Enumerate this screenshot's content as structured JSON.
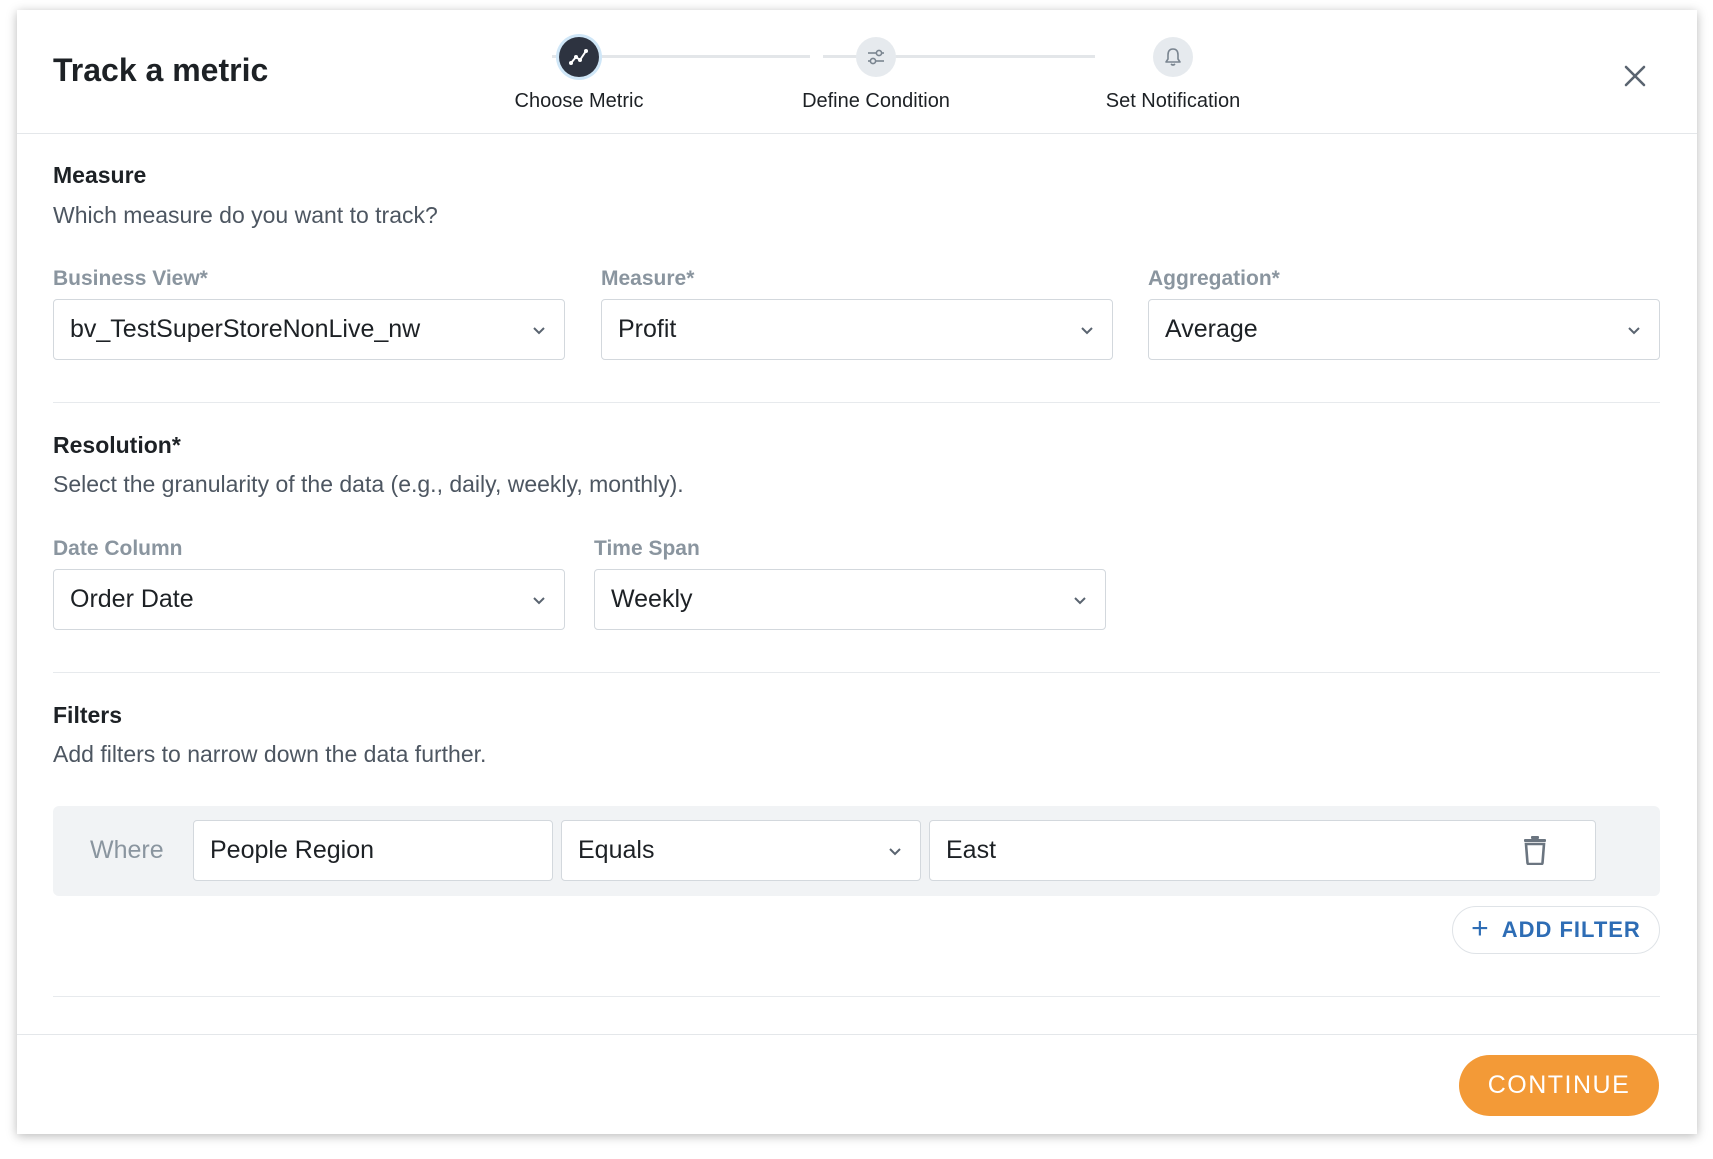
{
  "header": {
    "title": "Track a metric",
    "close_icon": "close-icon",
    "steps": [
      {
        "label": "Choose Metric",
        "icon": "metric-chart-icon",
        "active": true
      },
      {
        "label": "Define Condition",
        "icon": "sliders-icon",
        "active": false
      },
      {
        "label": "Set Notification",
        "icon": "bell-icon",
        "active": false
      }
    ]
  },
  "measure_section": {
    "title": "Measure",
    "description": "Which measure do you want to track?",
    "business_view": {
      "label": "Business View*",
      "value": "bv_TestSuperStoreNonLive_nw"
    },
    "measure": {
      "label": "Measure*",
      "value": "Profit"
    },
    "aggregation": {
      "label": "Aggregation*",
      "value": "Average"
    }
  },
  "resolution_section": {
    "title": "Resolution*",
    "description": "Select the granularity of the data (e.g., daily, weekly, monthly).",
    "date_column": {
      "label": "Date Column",
      "value": "Order Date"
    },
    "time_span": {
      "label": "Time Span",
      "value": "Weekly"
    }
  },
  "filters_section": {
    "title": "Filters",
    "description": "Add filters to narrow down the data further.",
    "filters": [
      {
        "prefix": "Where",
        "field": "People Region",
        "operator": "Equals",
        "value": "East"
      }
    ],
    "add_filter_label": "ADD FILTER"
  },
  "footer": {
    "continue_label": "CONTINUE"
  },
  "colors": {
    "accent": "#f39a37",
    "link": "#2e6db5",
    "active_step": "#2d3340"
  }
}
